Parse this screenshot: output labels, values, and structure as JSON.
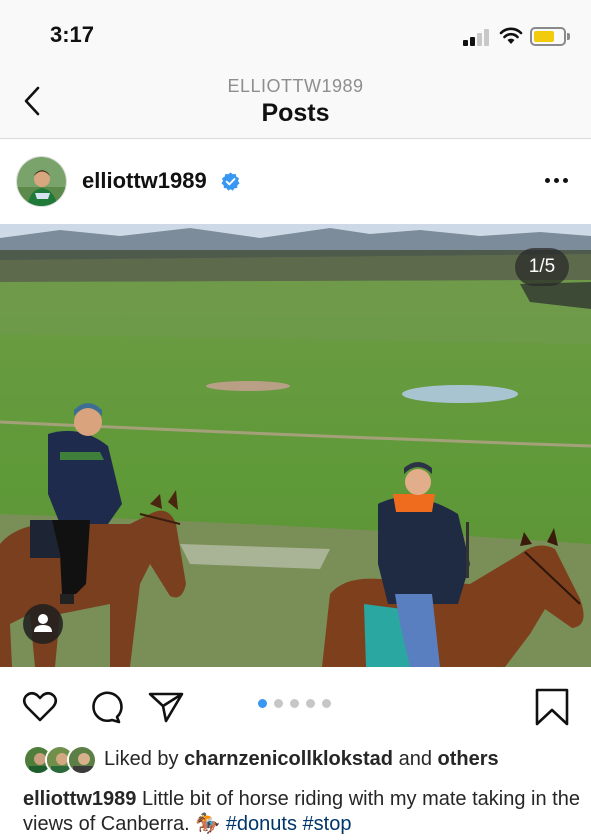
{
  "status_bar": {
    "time": "3:17"
  },
  "nav": {
    "username": "ELLIOTTW1989",
    "title": "Posts"
  },
  "post": {
    "username": "elliottw1989",
    "verified": true,
    "image_counter": "1/5",
    "carousel": {
      "total": 5,
      "active_index": 0
    }
  },
  "likes": {
    "prefix": "Liked by",
    "liker": "charnzenicollklokstad",
    "connector": "and",
    "others": "others"
  },
  "caption": {
    "username": "elliottw1989",
    "text": "Little bit of horse riding with my mate taking in the views of Canberra.",
    "emoji": "🏇",
    "hashtags": [
      "#donuts",
      "#stop"
    ]
  },
  "icons": {
    "back": "chevron-left-icon",
    "verified": "verified-badge-icon",
    "more": "more-dots-icon",
    "like": "heart-icon",
    "comment": "comment-icon",
    "share": "send-icon",
    "save": "bookmark-icon",
    "tag": "person-tag-icon"
  },
  "colors": {
    "accent": "#3897f0",
    "hashtag": "#003569",
    "verified": "#3897f0"
  }
}
